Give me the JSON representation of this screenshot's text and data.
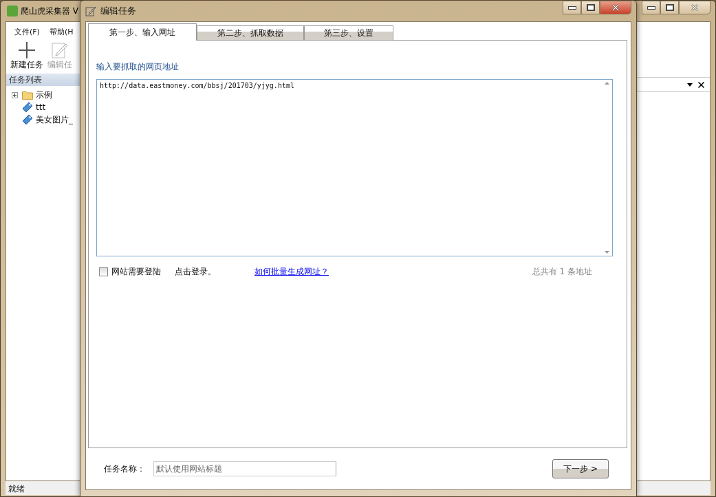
{
  "app": {
    "title": "爬山虎采集器 V",
    "menu": [
      {
        "label": "文件(F)"
      },
      {
        "label": "帮助(H"
      }
    ],
    "toolbar": [
      {
        "label": "新建任务",
        "kind": "new",
        "disabled": false
      },
      {
        "label": "编辑任",
        "kind": "edit",
        "disabled": true
      }
    ],
    "task_panel": {
      "title": "任务列表",
      "tree": [
        {
          "label": "示例",
          "kind": "folder",
          "expanded": false
        },
        {
          "label": "ttt",
          "kind": "task"
        },
        {
          "label": "美女图片_",
          "kind": "task"
        }
      ]
    },
    "status_bar": "就绪"
  },
  "dialog": {
    "title": "编辑任务",
    "tabs": [
      {
        "label": "第一步、输入网址",
        "selected": true
      },
      {
        "label": "第二步、抓取数据",
        "selected": false
      },
      {
        "label": "第三步、设置",
        "selected": false
      }
    ],
    "url_label": "输入要抓取的网页地址",
    "urls": "http://data.eastmoney.com/bbsj/201703/yjyg.html",
    "login": {
      "label": "网站需要登陆",
      "checked": false
    },
    "login_hint": "点击登录。",
    "help_link": "如何批量生成网址？",
    "count": {
      "prefix": "总共有",
      "value": "1",
      "suffix": "条地址"
    },
    "task_name": {
      "label": "任务名称：",
      "placeholder": "默认使用网站标题"
    },
    "next_button": "下一步 >"
  }
}
